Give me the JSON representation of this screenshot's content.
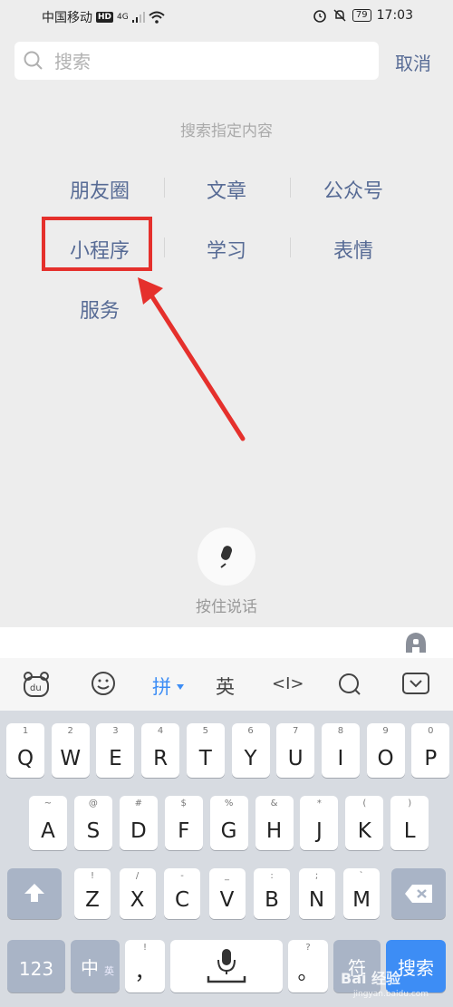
{
  "status_bar": {
    "carrier": "中国移动",
    "hd": "HD",
    "network": "4G",
    "battery": "79",
    "time": "17:03"
  },
  "search": {
    "placeholder": "搜索",
    "cancel_label": "取消"
  },
  "hint_text": "搜索指定内容",
  "options": [
    "朋友圈",
    "文章",
    "公众号",
    "小程序",
    "学习",
    "表情",
    "服务"
  ],
  "voice": {
    "label": "按住说话"
  },
  "keyboard_toolbar": {
    "pinyin": "拼",
    "english": "英",
    "cursor": "<I>"
  },
  "keyboard": {
    "row1": [
      {
        "k": "Q",
        "s": "1"
      },
      {
        "k": "W",
        "s": "2"
      },
      {
        "k": "E",
        "s": "3"
      },
      {
        "k": "R",
        "s": "4"
      },
      {
        "k": "T",
        "s": "5"
      },
      {
        "k": "Y",
        "s": "6"
      },
      {
        "k": "U",
        "s": "7"
      },
      {
        "k": "I",
        "s": "8"
      },
      {
        "k": "O",
        "s": "9"
      },
      {
        "k": "P",
        "s": "0"
      }
    ],
    "row2": [
      {
        "k": "A",
        "s": "~"
      },
      {
        "k": "S",
        "s": "@"
      },
      {
        "k": "D",
        "s": "#"
      },
      {
        "k": "F",
        "s": "$"
      },
      {
        "k": "G",
        "s": "%"
      },
      {
        "k": "H",
        "s": "&"
      },
      {
        "k": "J",
        "s": "*"
      },
      {
        "k": "K",
        "s": "("
      },
      {
        "k": "L",
        "s": ")"
      }
    ],
    "row3": [
      {
        "k": "Z",
        "s": "!"
      },
      {
        "k": "X",
        "s": "/"
      },
      {
        "k": "C",
        "s": "-"
      },
      {
        "k": "V",
        "s": "_"
      },
      {
        "k": "B",
        "s": ":"
      },
      {
        "k": "N",
        "s": ";"
      },
      {
        "k": "M",
        "s": "`"
      }
    ],
    "num_label": "123",
    "lang_label": "中",
    "lang_sub": "英",
    "comma": "，",
    "comma_sub": "!",
    "period": "。",
    "period_sub": "?",
    "symbol_label": "符",
    "search_label": "搜索"
  },
  "watermark": {
    "line1": "Bai 经验",
    "line2": "jingyan.baidu.com"
  }
}
